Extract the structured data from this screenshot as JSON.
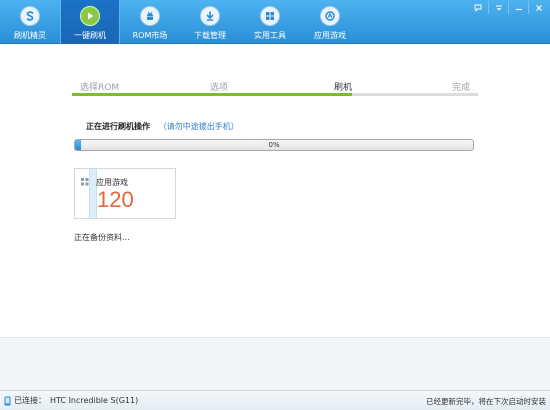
{
  "nav": {
    "tabs": [
      {
        "label": "刷机精灵",
        "icon": "logo-icon",
        "active": false
      },
      {
        "label": "一键刷机",
        "icon": "play-icon",
        "active": true
      },
      {
        "label": "ROM市场",
        "icon": "android-icon",
        "active": false
      },
      {
        "label": "下载管理",
        "icon": "download-icon",
        "active": false
      },
      {
        "label": "实用工具",
        "icon": "tools-grid-icon",
        "active": false
      },
      {
        "label": "应用游戏",
        "icon": "app-store-icon",
        "active": false
      }
    ],
    "window_controls": [
      "feedback-icon",
      "menu-icon",
      "minimize-icon",
      "close-icon"
    ]
  },
  "steps": {
    "items": [
      "选择ROM",
      "选项",
      "刷机",
      "完成"
    ],
    "current_index": 2,
    "progress_fraction": 0.69
  },
  "operation": {
    "title": "正在进行刷机操作",
    "note": "（请勿中途拔出手机）",
    "progress_percent": 0,
    "progress_text": "0%"
  },
  "card": {
    "label": "应用游戏",
    "value": "120"
  },
  "status_message": "正在备份资料...",
  "statusbar": {
    "connected_label": "已连接：",
    "device": "HTC Incredible S(G11)",
    "update_msg": "已经更新完毕，将在下次启动时安装"
  },
  "colors": {
    "nav_bg": "#3a9fe3",
    "nav_active": "#1a6bbd",
    "step_fill": "#7cbd30",
    "progress_fill": "#2a8ad6",
    "card_value": "#e0673b"
  }
}
